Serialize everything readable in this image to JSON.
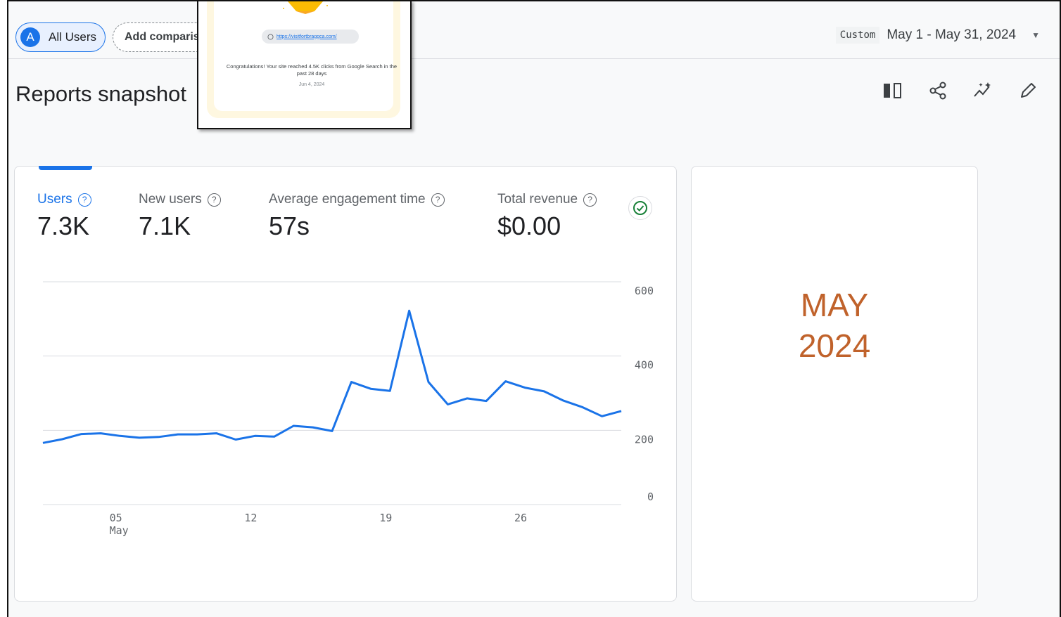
{
  "filters": {
    "segment_letter": "A",
    "segment_label": "All Users",
    "add_comparison_label": "Add comparison"
  },
  "date": {
    "tag": "Custom",
    "range": "May 1 - May 31, 2024"
  },
  "page_title": "Reports snapshot",
  "popup": {
    "url": "https://visitfortbraggca.com/",
    "message": "Congratulations! Your site reached 4.5K clicks from Google Search in the past 28 days",
    "date": "Jun 4, 2024"
  },
  "metrics": [
    {
      "label": "Users",
      "value": "7.3K"
    },
    {
      "label": "New users",
      "value": "7.1K"
    },
    {
      "label": "Average engagement time",
      "value": "57s"
    },
    {
      "label": "Total revenue",
      "value": "$0.00"
    }
  ],
  "side_card": {
    "line1": "MAY",
    "line2": "2024"
  },
  "chart_data": {
    "type": "line",
    "y_ticks": [
      "600",
      "400",
      "200",
      "0"
    ],
    "x_ticks": [
      {
        "label": "05",
        "sub": "May",
        "day": 5
      },
      {
        "label": "12",
        "sub": "",
        "day": 12
      },
      {
        "label": "19",
        "sub": "",
        "day": 19
      },
      {
        "label": "26",
        "sub": "",
        "day": 26
      }
    ],
    "ylim": [
      0,
      600
    ],
    "series": [
      {
        "color": "#1a73e8",
        "x": [
          1,
          2,
          3,
          4,
          5,
          6,
          7,
          8,
          9,
          10,
          11,
          12,
          13,
          14,
          15,
          16,
          17,
          18,
          19,
          20,
          21,
          22,
          23,
          24,
          25,
          26,
          27,
          28,
          29,
          30,
          31
        ],
        "values": [
          166,
          176,
          190,
          192,
          185,
          180,
          182,
          189,
          189,
          192,
          175,
          185,
          183,
          212,
          208,
          198,
          330,
          312,
          306,
          522,
          330,
          270,
          286,
          279,
          332,
          315,
          305,
          280,
          262,
          238,
          252
        ]
      }
    ]
  }
}
